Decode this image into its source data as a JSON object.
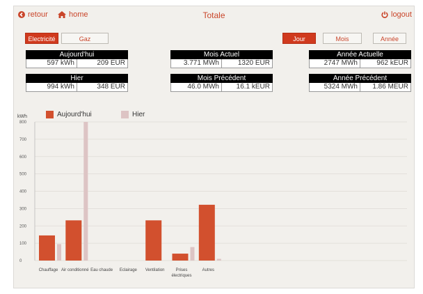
{
  "header": {
    "back": "retour",
    "home": "home",
    "title": "Totale",
    "logout": "logout"
  },
  "energy_tabs": [
    {
      "label": "Electricité",
      "active": true
    },
    {
      "label": "Gaz",
      "active": false
    }
  ],
  "period_tabs": [
    {
      "label": "Jour",
      "active": true
    },
    {
      "label": "Mois",
      "active": false
    },
    {
      "label": "Année",
      "active": false
    }
  ],
  "stats": {
    "today": {
      "title": "Aujourd'hui",
      "energy": "597 kWh",
      "cost": "209 EUR"
    },
    "yesterday": {
      "title": "Hier",
      "energy": "994 kWh",
      "cost": "348 EUR"
    },
    "current_month": {
      "title": "Mois Actuel",
      "energy": "3.771 MWh",
      "cost": "1320 EUR"
    },
    "previous_month": {
      "title": "Mois Précédent",
      "energy": "46.0 MWh",
      "cost": "16.1 kEUR"
    },
    "current_year": {
      "title": "Année Actuelle",
      "energy": "2747 MWh",
      "cost": "962 kEUR"
    },
    "previous_year": {
      "title": "Année Précédent",
      "energy": "5324 MWh",
      "cost": "1.86 MEUR"
    }
  },
  "chart_data": {
    "type": "bar",
    "ylabel": "kWh",
    "ylim": [
      0,
      800
    ],
    "yticks": [
      0,
      100,
      200,
      300,
      400,
      500,
      600,
      700,
      800
    ],
    "categories": [
      "Chauffage",
      "Air conditionné",
      "Eau chaude",
      "Eclairage",
      "Ventilation",
      "Prises électriques",
      "Autres"
    ],
    "series": [
      {
        "name": "Aujourd'hui",
        "color": "#d2502e",
        "values": [
          145,
          232,
          0,
          0,
          232,
          40,
          322
        ]
      },
      {
        "name": "Hier",
        "color": "#ddc4c4",
        "values": [
          95,
          800,
          0,
          0,
          0,
          78,
          10
        ]
      }
    ],
    "grid": true,
    "legend": "top-left"
  }
}
